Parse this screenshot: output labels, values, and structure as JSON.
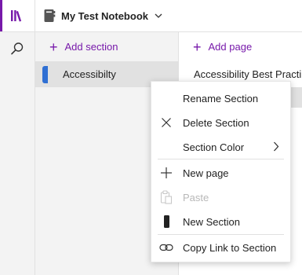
{
  "notebook": {
    "title": "My Test Notebook"
  },
  "sections_pane": {
    "add_label": "Add section",
    "items": [
      {
        "label": "Accessibilty",
        "color": "#2f6fd3"
      }
    ]
  },
  "pages_pane": {
    "add_label": "Add page",
    "items": [
      {
        "label": "Accessibility Best Practi..."
      }
    ]
  },
  "context_menu": {
    "items": [
      {
        "label": "Rename Section",
        "icon": "none"
      },
      {
        "label": "Delete Section",
        "icon": "close-icon"
      },
      {
        "label": "Section Color",
        "icon": "none",
        "submenu": true
      },
      {
        "label": "New page",
        "icon": "plus-icon"
      },
      {
        "label": "Paste",
        "icon": "paste-icon",
        "disabled": true
      },
      {
        "label": "New Section",
        "icon": "section-icon"
      },
      {
        "label": "Copy Link to Section",
        "icon": "link-icon"
      }
    ]
  },
  "colors": {
    "accent": "#7719aa",
    "section_tab": "#2f6fd3",
    "pane_background": "#f3f3f3",
    "selected_background": "#e1e1e1",
    "disabled_text": "#b8b8b8"
  }
}
